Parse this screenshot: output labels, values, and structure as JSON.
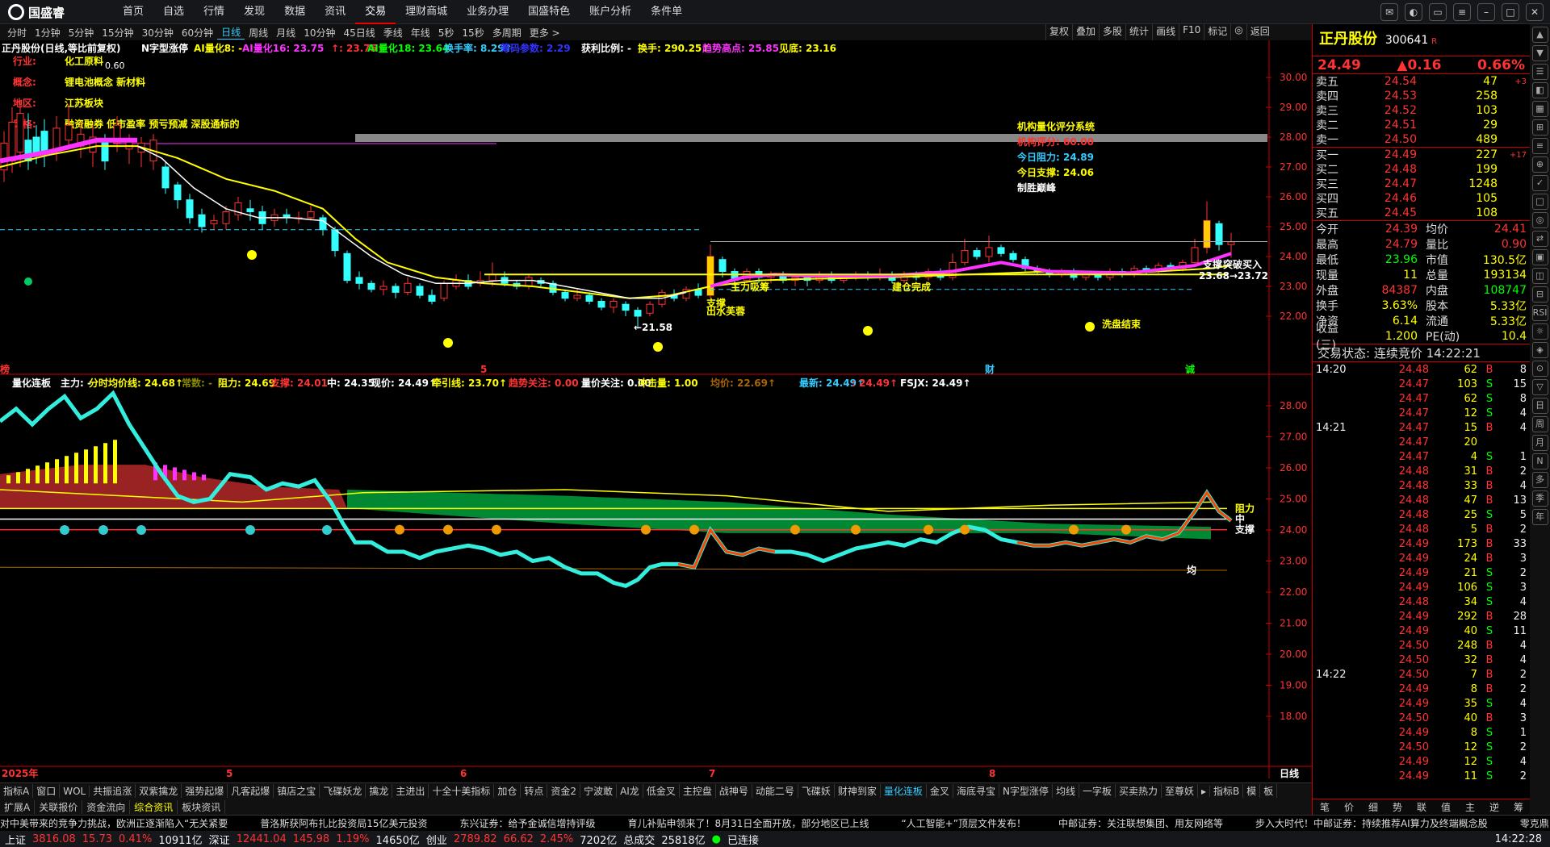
{
  "app": {
    "logo_text": "国盛睿"
  },
  "menu": [
    "首页",
    "自选",
    "行情",
    "发现",
    "数据",
    "资讯",
    "交易",
    "理财商城",
    "业务办理",
    "国盛特色",
    "账户分析",
    "条件单"
  ],
  "menu_active": 6,
  "periods": [
    "分时",
    "1分钟",
    "5分钟",
    "15分钟",
    "30分钟",
    "60分钟",
    "日线",
    "周线",
    "月线",
    "10分钟",
    "45日线",
    "季线",
    "年线",
    "5秒",
    "15秒",
    "多周期",
    "更多 >"
  ],
  "period_selected": 6,
  "right_tools": [
    "复权",
    "叠加",
    "多股",
    "统计",
    "画线",
    "F10",
    "标记",
    "◎",
    "返回"
  ],
  "chart_header": {
    "stock": "正丹股份(日线,等比前复权)",
    "b1": "N字型涨停",
    "b2": "AI量化8: -",
    "b3": "AI量化16: 23.75",
    "b4": "↑: 23.75↑",
    "b5": "AI量化18: 23.64",
    "b6": "换手率: 8.29↑",
    "b7": "筹码参数: 2.29",
    "b8": "获利比例: -",
    "b9": "换手: 290.25↑",
    "b10": "趋势高点: 25.85",
    "b11": "见底: 23.16"
  },
  "info": {
    "industry_k": "行业:",
    "industry_v": "化工原料",
    "concept_k": "概念:",
    "concept_v": "锂电池概念 新材料",
    "region_k": "地区:",
    "region_v": "江苏板块",
    "style_k": "风格:",
    "style_v": "融资融券 低市盈率 预亏预减 深股通标的",
    "tag": "0.60"
  },
  "score": {
    "title": "机构量化评分系统",
    "l1": "机构评分: 60.00",
    "l2": "今日阻力: 24.89",
    "l3": "今日支撑: 24.06",
    "l4": "制胜巅峰"
  },
  "annot": {
    "a1": "支撑",
    "a2": "出水芙蓉",
    "a3": "主力吸筹",
    "a4": "建仓完成",
    "a5": "洗盘结束",
    "a6": "支撑",
    "a7": "突破买入",
    "a8": "←21.58",
    "a9": "23.68→23.72",
    "m1": "财",
    "m2": "诚",
    "m3": "5",
    "m4": "榜"
  },
  "price_axis": [
    "30.00",
    "29.00",
    "28.00",
    "27.00",
    "26.00",
    "25.00",
    "24.00",
    "23.00",
    "22.00"
  ],
  "lower_header": {
    "name": "量化连板",
    "b1": "主力: -",
    "b2": "分时均价线: 24.68↑",
    "b3": "常数: -",
    "b4": "阻力: 24.69",
    "b5": "支撑: 24.01",
    "b6": "中: 24.35",
    "b7": "现价: 24.49↑",
    "b8": "牵引线: 23.70↑",
    "b9": "趋势关注: 0.00",
    "b10": "量价关注: 0.00",
    "b11": "冲击量: 1.00",
    "b12": "均价: 22.69↑",
    "b13": "最新: 24.49↑",
    "b14": ": 24.49↑",
    "b15": "FSJX: 24.49↑"
  },
  "lower_axis": [
    "28.00",
    "27.00",
    "26.00",
    "25.00",
    "24.00",
    "23.00",
    "22.00",
    "21.00",
    "20.00",
    "19.00",
    "18.00"
  ],
  "lower_labels": {
    "r": "阻力",
    "m": "中",
    "s": "支撑",
    "avg": "均"
  },
  "date_axis": {
    "y": "2025年",
    "m5": "5",
    "m6": "6",
    "m7": "7",
    "m8": "8",
    "period": "日线"
  },
  "tabs1": [
    "指标A",
    "窗口",
    "WOL",
    "共振追涨",
    "双紫擒龙",
    "强势起爆",
    "凡客起爆",
    "镇店之宝",
    "飞碟妖龙",
    "擒龙",
    "主进出",
    "十全十美指标",
    "加仓",
    "转点",
    "资金2",
    "宁波敢",
    "AI龙",
    "低金叉",
    "主控盘",
    "战神号",
    "动能二号",
    "飞碟妖",
    "财神到家",
    "量化连板",
    "金叉",
    "海底寻宝",
    "N字型涨停",
    "均线",
    "一字板",
    "买卖热力",
    "至尊妖",
    "▸",
    "指标B",
    "模",
    "板"
  ],
  "tabs1_sel": 23,
  "tabs2": [
    "扩展A",
    "关联报价",
    "资金流向",
    "综合资讯",
    "板块资讯"
  ],
  "tabs2_sel": 3,
  "ticker": [
    "对中美带来的竞争力挑战，欧洲正逐渐陷入“无关紧要",
    "普洛斯获阿布扎比投资局15亿美元投资",
    "东兴证券：给予金诚信增持评级",
    "育儿补贴申领来了！8月31日全面开放，部分地区已上线",
    "“人工智能+”顶层文件发布！",
    "中邮证券：关注联想集团、用友网络等",
    "步入大时代！中邮证券：持续推荐AI算力及终端概念股",
    "零克鼎"
  ],
  "status": {
    "sh_k": "上证",
    "sh_v": "3816.08",
    "sh_c": "15.73",
    "sh_p": "0.41%",
    "sh_a": "10911亿",
    "sz_k": "深证",
    "sz_v": "12441.04",
    "sz_c": "145.98",
    "sz_p": "1.19%",
    "sz_a": "14650亿",
    "cy_k": "创业",
    "cy_v": "2789.82",
    "cy_c": "66.62",
    "cy_p": "2.45%",
    "cy_a": "7202亿",
    "tot_k": "总成交",
    "tot_v": "25818亿",
    "conn": "已连接",
    "time": "14:22:28"
  },
  "side": {
    "name": "正丹股份",
    "code": "300641",
    "rbadge": "R",
    "price": "24.49",
    "chg": "▲0.16",
    "pct": "0.66%",
    "asks": [
      [
        "卖五",
        "24.54",
        "47",
        "+3"
      ],
      [
        "卖四",
        "24.53",
        "258",
        ""
      ],
      [
        "卖三",
        "24.52",
        "103",
        ""
      ],
      [
        "卖二",
        "24.51",
        "29",
        ""
      ],
      [
        "卖一",
        "24.50",
        "489",
        ""
      ]
    ],
    "bids": [
      [
        "买一",
        "24.49",
        "227",
        "+17"
      ],
      [
        "买二",
        "24.48",
        "199",
        ""
      ],
      [
        "买三",
        "24.47",
        "1248",
        ""
      ],
      [
        "买四",
        "24.46",
        "105",
        ""
      ],
      [
        "买五",
        "24.45",
        "108",
        ""
      ]
    ],
    "stats": [
      [
        "今开",
        "24.39",
        "均价",
        "24.41"
      ],
      [
        "最高",
        "24.79",
        "量比",
        "0.90"
      ],
      [
        "最低",
        "23.96",
        "市值",
        "130.5亿"
      ],
      [
        "现量",
        "11",
        "总量",
        "193134"
      ],
      [
        "外盘",
        "84387",
        "内盘",
        "108747"
      ],
      [
        "换手",
        "3.63%",
        "股本",
        "5.33亿"
      ],
      [
        "净资",
        "6.14",
        "流通",
        "5.33亿"
      ],
      [
        "收益(三)",
        "1.200",
        "PE(动)",
        "10.4"
      ]
    ],
    "trade_state": "交易状态: 连续竞价 14:22:21",
    "ticks": [
      [
        "14:20",
        "24.48",
        "62",
        "B",
        "8"
      ],
      [
        "",
        "24.47",
        "103",
        "S",
        "15"
      ],
      [
        "",
        "24.47",
        "62",
        "S",
        "8"
      ],
      [
        "",
        "24.47",
        "12",
        "S",
        "4"
      ],
      [
        "14:21",
        "24.47",
        "15",
        "B",
        "4"
      ],
      [
        "",
        "24.47",
        "20",
        "",
        ""
      ],
      [
        "",
        "24.47",
        "4",
        "S",
        "1"
      ],
      [
        "",
        "24.48",
        "31",
        "B",
        "2"
      ],
      [
        "",
        "24.48",
        "33",
        "B",
        "4"
      ],
      [
        "",
        "24.48",
        "47",
        "B",
        "13"
      ],
      [
        "",
        "24.48",
        "25",
        "S",
        "5"
      ],
      [
        "",
        "24.48",
        "5",
        "B",
        "2"
      ],
      [
        "",
        "24.49",
        "173",
        "B",
        "33"
      ],
      [
        "",
        "24.49",
        "24",
        "B",
        "3"
      ],
      [
        "",
        "24.49",
        "21",
        "S",
        "2"
      ],
      [
        "",
        "24.49",
        "106",
        "S",
        "3"
      ],
      [
        "",
        "24.48",
        "34",
        "S",
        "4"
      ],
      [
        "",
        "24.49",
        "292",
        "B",
        "28"
      ],
      [
        "",
        "24.49",
        "40",
        "S",
        "11"
      ],
      [
        "",
        "24.50",
        "248",
        "B",
        "4"
      ],
      [
        "",
        "24.50",
        "32",
        "B",
        "4"
      ],
      [
        "14:22",
        "24.50",
        "7",
        "B",
        "2"
      ],
      [
        "",
        "24.49",
        "8",
        "B",
        "2"
      ],
      [
        "",
        "24.49",
        "35",
        "S",
        "4"
      ],
      [
        "",
        "24.50",
        "40",
        "B",
        "3"
      ],
      [
        "",
        "24.49",
        "8",
        "S",
        "1"
      ],
      [
        "",
        "24.50",
        "12",
        "S",
        "2"
      ],
      [
        "",
        "24.49",
        "12",
        "S",
        "4"
      ],
      [
        "",
        "24.49",
        "11",
        "S",
        "2"
      ]
    ],
    "tabs": [
      "笔",
      "价",
      "细",
      "势",
      "联",
      "值",
      "主",
      "逆",
      "筹"
    ]
  },
  "vicons": [
    "▲",
    "▼",
    "☰",
    "◧",
    "▦",
    "⊞",
    "≡",
    "⊕",
    "✓",
    "□",
    "◎",
    "⇄",
    "▣",
    "◫",
    "⊟",
    "RSI",
    "☼",
    "◈",
    "⊙",
    "▽",
    "日",
    "周",
    "月",
    "N",
    "多",
    "季",
    "年"
  ]
}
